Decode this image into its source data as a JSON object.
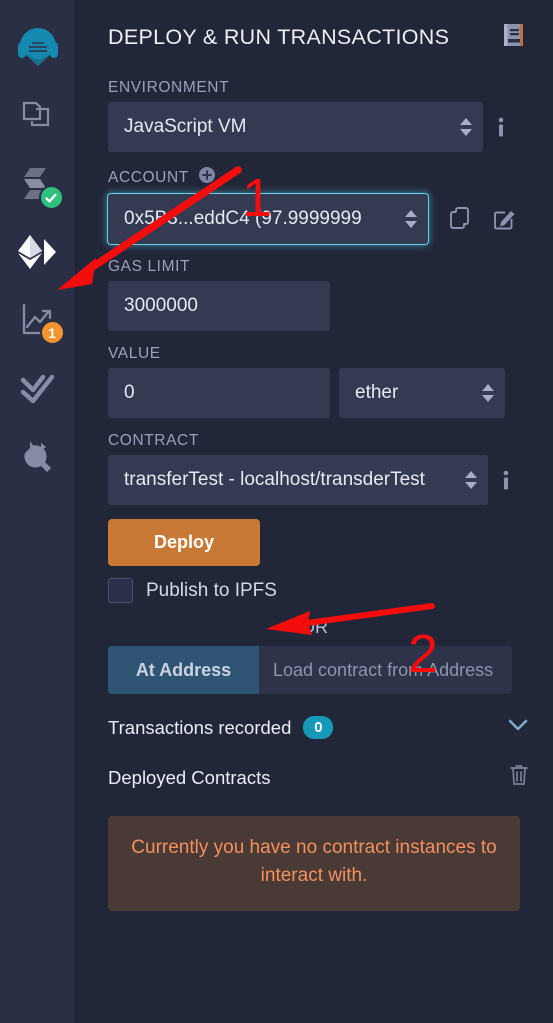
{
  "sidebar": {
    "items": [
      {
        "name": "remix-logo-icon",
        "label": "Remix Home"
      },
      {
        "name": "file-explorer-icon",
        "label": "File Explorers"
      },
      {
        "name": "solidity-compiler-icon",
        "label": "Solidity Compiler",
        "badge": "check"
      },
      {
        "name": "deploy-run-icon",
        "label": "Deploy & Run Transactions",
        "active": true
      },
      {
        "name": "debugger-icon",
        "label": "Debugger",
        "badge_count": "1"
      },
      {
        "name": "solidity-analyzers-icon",
        "label": "Solidity Analyzers"
      },
      {
        "name": "plugin-manager-icon",
        "label": "Plugin Manager"
      }
    ],
    "badge_count_debugger": "1"
  },
  "header": {
    "title": "DEPLOY & RUN TRANSACTIONS",
    "doc_icon": "book-icon"
  },
  "environment": {
    "label": "ENVIRONMENT",
    "value": "JavaScript VM",
    "info_icon": "info-icon"
  },
  "account": {
    "label": "ACCOUNT",
    "add_icon": "plus-circle-icon",
    "value": "0x5B3...eddC4 (97.9999999",
    "copy_icon": "copy-icon",
    "edit_icon": "edit-icon"
  },
  "gas_limit": {
    "label": "GAS LIMIT",
    "value": "3000000"
  },
  "value_field": {
    "label": "VALUE",
    "value": "0",
    "unit": "ether"
  },
  "contract": {
    "label": "CONTRACT",
    "value": "transferTest - localhost/transderTest",
    "info_icon": "info-icon"
  },
  "deploy": {
    "button_label": "Deploy",
    "publish_ipfs_label": "Publish to IPFS",
    "publish_ipfs_checked": false,
    "or_label": "OR",
    "at_address_button": "At Address",
    "at_address_placeholder": "Load contract from Address"
  },
  "transactions": {
    "label": "Transactions recorded",
    "count": "0",
    "chevron_icon": "chevron-down-icon"
  },
  "deployed_contracts": {
    "label": "Deployed Contracts",
    "trash_icon": "trash-icon",
    "empty_message": "Currently you have no contract instances to interact with."
  },
  "annotations": {
    "marker_1": "1",
    "marker_2": "2",
    "arrow_1_target": "deploy-run-icon",
    "arrow_2_target": "deploy-button",
    "color": "#f40d0d"
  },
  "colors": {
    "background": "#222639",
    "rail_background": "#2a2f45",
    "input_background": "#343a52",
    "deploy_orange": "#c77935",
    "at_address_blue": "#2f5474",
    "pill_cyan": "#1699b8",
    "badge_orange": "#f4932f",
    "badge_green": "#2ec27e",
    "alert_background": "#4a3a36",
    "alert_text": "#f4905e",
    "focus_glow": "#5fd3e8"
  }
}
